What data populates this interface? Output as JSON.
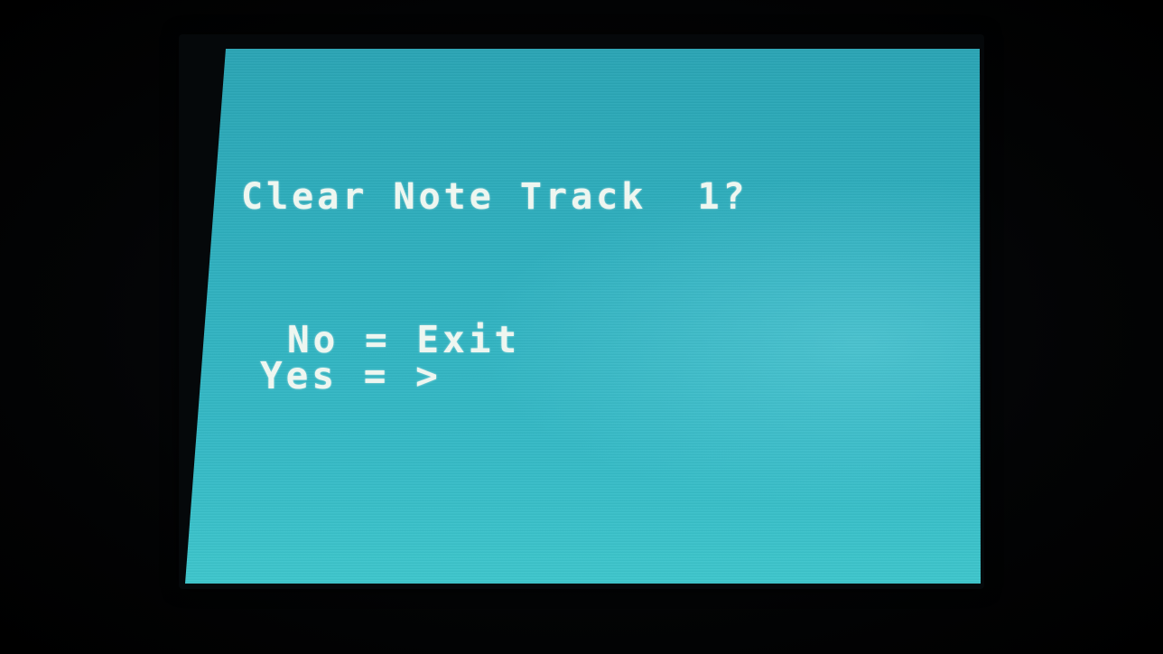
{
  "screen": {
    "title": "Clear Note Track  1?",
    "option_no": "No = Exit",
    "option_yes": "Yes = >"
  },
  "colors": {
    "lcd_background": "#31b3c1",
    "lcd_text": "#eef6f0",
    "bezel": "#05080a"
  }
}
